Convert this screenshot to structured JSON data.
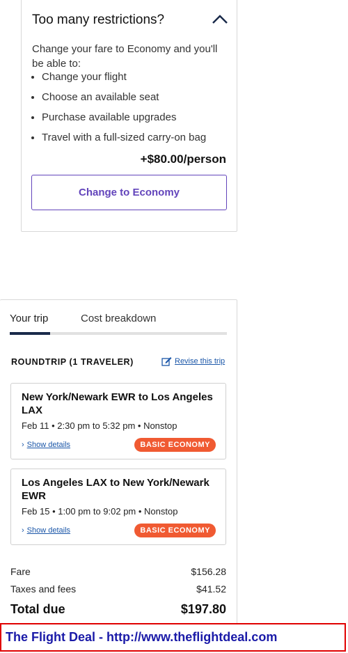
{
  "restrictions": {
    "title": "Too many restrictions?",
    "intro": "Change your fare to Economy and you'll be able to:",
    "benefits": [
      "Change your flight",
      "Choose an available seat",
      "Purchase available upgrades",
      "Travel with a full-sized carry-on bag"
    ],
    "price": "+$80.00/person",
    "button_label": "Change to Economy"
  },
  "trip": {
    "tabs": [
      "Your trip",
      "Cost breakdown"
    ],
    "active_tab": "Your trip",
    "trip_type": "ROUNDTRIP (1 TRAVELER)",
    "revise_label": "Revise this trip",
    "segments": [
      {
        "route": "New York/Newark EWR to Los Angeles LAX",
        "time": "Feb 11 • 2:30 pm to 5:32 pm • Nonstop",
        "details_label": "Show details",
        "fare_class": "BASIC ECONOMY"
      },
      {
        "route": "Los Angeles LAX to New York/Newark EWR",
        "time": "Feb 15 • 1:00 pm to 9:02 pm • Nonstop",
        "details_label": "Show details",
        "fare_class": "BASIC ECONOMY"
      }
    ],
    "costs": {
      "fare_label": "Fare",
      "fare_value": "$156.28",
      "taxes_label": "Taxes and fees",
      "taxes_value": "$41.52",
      "total_label": "Total due",
      "total_value": "$197.80"
    }
  },
  "banner": {
    "text": "The Flight Deal - http://www.theflightdeal.com"
  },
  "colors": {
    "accent_purple": "#6244bb",
    "badge_orange": "#f05a32",
    "link_blue": "#1a56a8",
    "banner_border": "#e00000",
    "banner_text": "#1a1aa8"
  }
}
